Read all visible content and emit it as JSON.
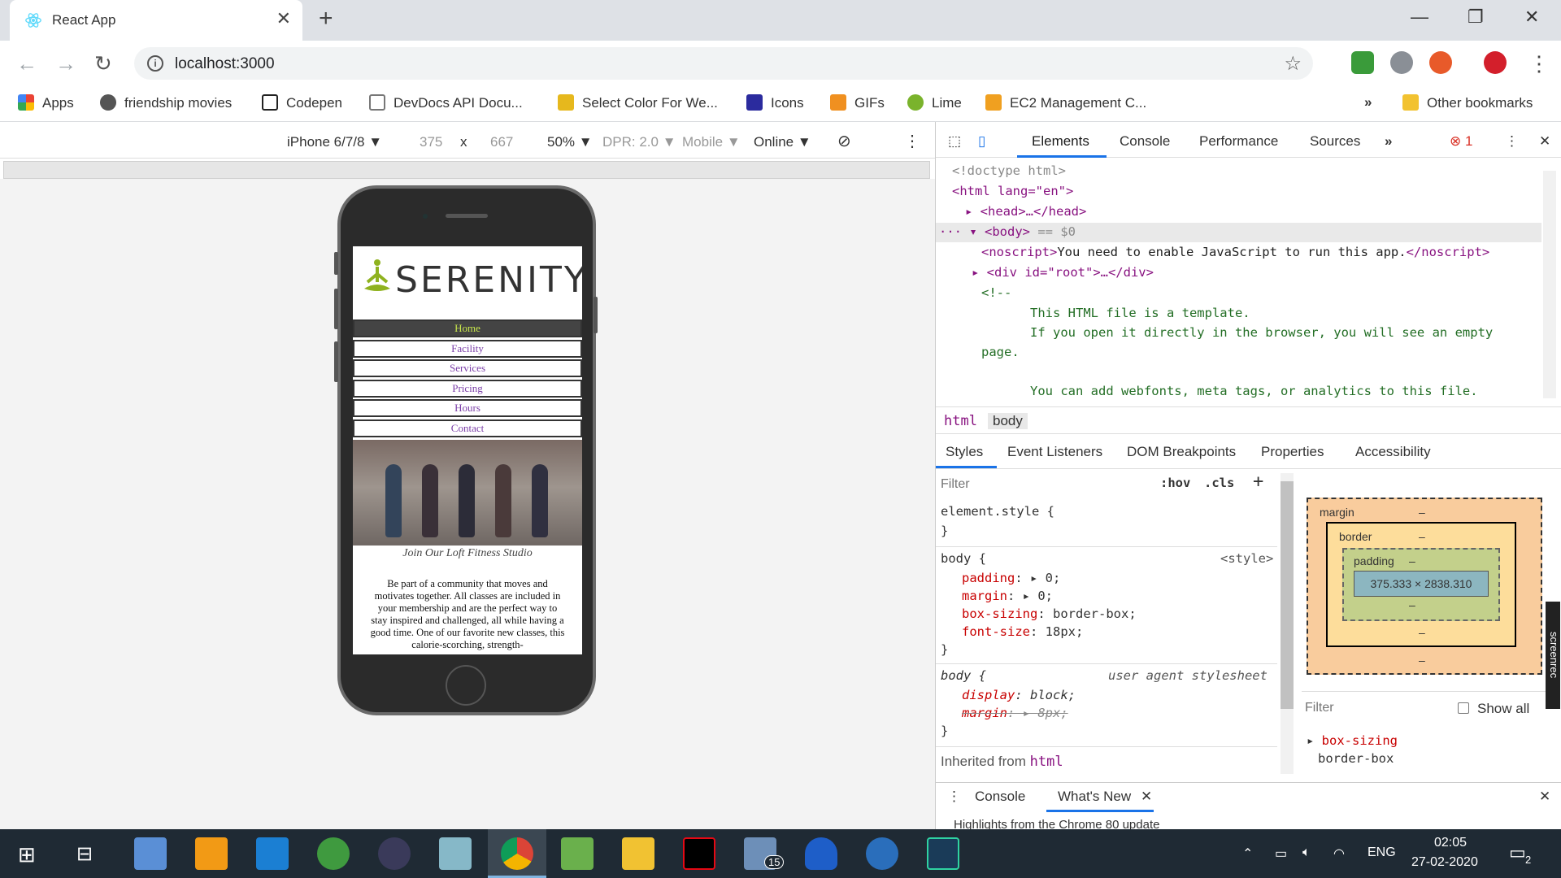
{
  "browser": {
    "tab_title": "React App",
    "url": "localhost:3000",
    "bookmarks": [
      {
        "label": "Apps",
        "icon": "apps-grid-icon"
      },
      {
        "label": "friendship movies",
        "icon": "globe-icon"
      },
      {
        "label": "Codepen",
        "icon": "codepen-icon"
      },
      {
        "label": "DevDocs API Docu...",
        "icon": "devdocs-icon"
      },
      {
        "label": "Select Color For We...",
        "icon": "color-icon"
      },
      {
        "label": "Icons",
        "icon": "icons-icon"
      },
      {
        "label": "GIFs",
        "icon": "gifs-icon"
      },
      {
        "label": "Lime",
        "icon": "lime-icon"
      },
      {
        "label": "EC2 Management C...",
        "icon": "aws-icon"
      }
    ],
    "other_bookmarks": "Other bookmarks",
    "more_bookmarks": "»"
  },
  "device_toolbar": {
    "device": "iPhone 6/7/8",
    "width": "375",
    "times": "x",
    "height": "667",
    "zoom": "50%",
    "dpr": "DPR: 2.0",
    "mode": "Mobile",
    "network": "Online"
  },
  "site": {
    "logo": "SERENITY",
    "nav": [
      "Home",
      "Facility",
      "Services",
      "Pricing",
      "Hours",
      "Contact"
    ],
    "caption": "Join Our Loft Fitness Studio",
    "paragraph": "Be part of a community that moves and motivates together. All classes are included in your membership and are the perfect way to stay inspired and challenged, all while having a good time. One of our favorite new classes, this calorie-scorching, strength-"
  },
  "devtools": {
    "tabs": [
      "Elements",
      "Console",
      "Performance",
      "Sources"
    ],
    "more": "»",
    "error_count": "1",
    "dom": {
      "doctype": "<!doctype html>",
      "html_open": "<html lang=\"en\">",
      "head": "<head>…</head>",
      "body": "<body>",
      "body_marker": "== $0",
      "noscript_text": "You need to enable JavaScript to run this app.",
      "root_div": "<div id=\"root\">…</div>",
      "comment_open": "<!--",
      "comment_1": "This HTML file is a template.",
      "comment_2": "If you open it directly in the browser, you will see an empty",
      "comment_3": "page.",
      "comment_4": "You can add webfonts, meta tags, or analytics to this file."
    },
    "breadcrumbs": [
      "html",
      "body"
    ],
    "styles_tabs": [
      "Styles",
      "Event Listeners",
      "DOM Breakpoints",
      "Properties",
      "Accessibility"
    ],
    "filter_placeholder": "Filter",
    "hov": ":hov",
    "cls": ".cls",
    "element_style": "element.style {",
    "body_rule": {
      "selector": "body {",
      "source": "<style>",
      "props": [
        [
          "padding",
          "0;"
        ],
        [
          "margin",
          "0;"
        ],
        [
          "box-sizing",
          "border-box;"
        ],
        [
          "font-size",
          "18px;"
        ]
      ]
    },
    "ua_rule": {
      "selector": "body {",
      "source": "user agent stylesheet",
      "props": [
        [
          "display",
          "block;"
        ],
        [
          "margin",
          "8px;"
        ]
      ]
    },
    "inherited": "Inherited from",
    "inherited_el": "html",
    "box_model": {
      "margin": "margin",
      "border": "border",
      "padding": "padding",
      "content": "375.333 × 2838.310",
      "dash": "–"
    },
    "computed_filter": "Filter",
    "show_all": "Show all",
    "computed_prop": "box-sizing",
    "computed_val": "border-box",
    "drawer_tabs": [
      "Console",
      "What's New"
    ],
    "drawer_text": "Highlights from the Chrome 80 update",
    "screenrec": "screenrec"
  },
  "taskbar": {
    "time": "02:05",
    "date": "27-02-2020",
    "lang": "ENG",
    "notifications": "2",
    "mail_badge": "15"
  }
}
